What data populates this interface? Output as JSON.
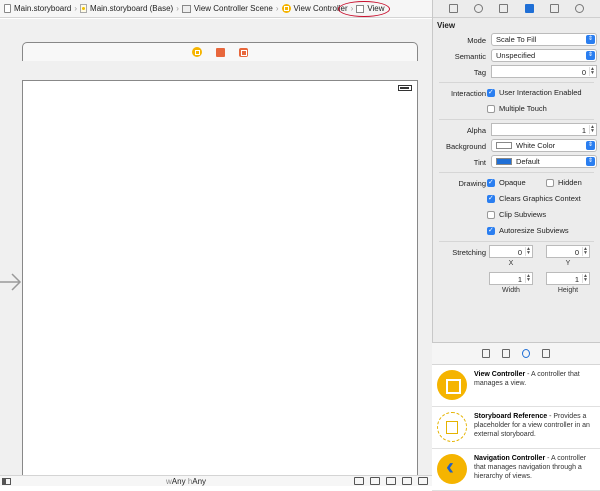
{
  "jumpbar": {
    "crumbs": [
      "Main.storyboard",
      "Main.storyboard (Base)",
      "View Controller Scene",
      "View Controller",
      "View"
    ]
  },
  "canvas": {
    "size_class_w": "w",
    "size_class_w_value": "Any",
    "size_class_h": "h",
    "size_class_h_value": "Any"
  },
  "inspector": {
    "section_title": "View",
    "mode_label": "Mode",
    "mode_value": "Scale To Fill",
    "semantic_label": "Semantic",
    "semantic_value": "Unspecified",
    "tag_label": "Tag",
    "tag_value": "0",
    "interaction_label": "Interaction",
    "user_interaction": "User Interaction Enabled",
    "multiple_touch": "Multiple Touch",
    "alpha_label": "Alpha",
    "alpha_value": "1",
    "background_label": "Background",
    "background_value": "White Color",
    "tint_label": "Tint",
    "tint_value": "Default",
    "drawing_label": "Drawing",
    "opaque": "Opaque",
    "hidden": "Hidden",
    "clears": "Clears Graphics Context",
    "clip": "Clip Subviews",
    "autoresize": "Autoresize Subviews",
    "stretching_label": "Stretching",
    "stretch_x": "0",
    "stretch_y": "0",
    "x_label": "X",
    "y_label": "Y",
    "width_value": "1",
    "height_value": "1",
    "width_label": "Width",
    "height_label": "Height",
    "checkbox_states": {
      "user_interaction": true,
      "multiple_touch": false,
      "opaque": true,
      "hidden": false,
      "clears": true,
      "clip": false,
      "autoresize": true
    },
    "colors": {
      "tint_swatch": "#1f6fd6",
      "background_swatch": "#ffffff",
      "accent": "#2a7ef0"
    }
  },
  "library": {
    "items": [
      {
        "title": "View Controller",
        "desc": " - A controller that manages a view.",
        "icon": "view-controller-icon"
      },
      {
        "title": "Storyboard Reference",
        "desc": " - Provides a placeholder for a view controller in an external storyboard.",
        "icon": "storyboard-reference-icon"
      },
      {
        "title": "Navigation Controller",
        "desc": " - A controller that manages navigation through a hierarchy of views.",
        "icon": "navigation-controller-icon"
      }
    ]
  }
}
